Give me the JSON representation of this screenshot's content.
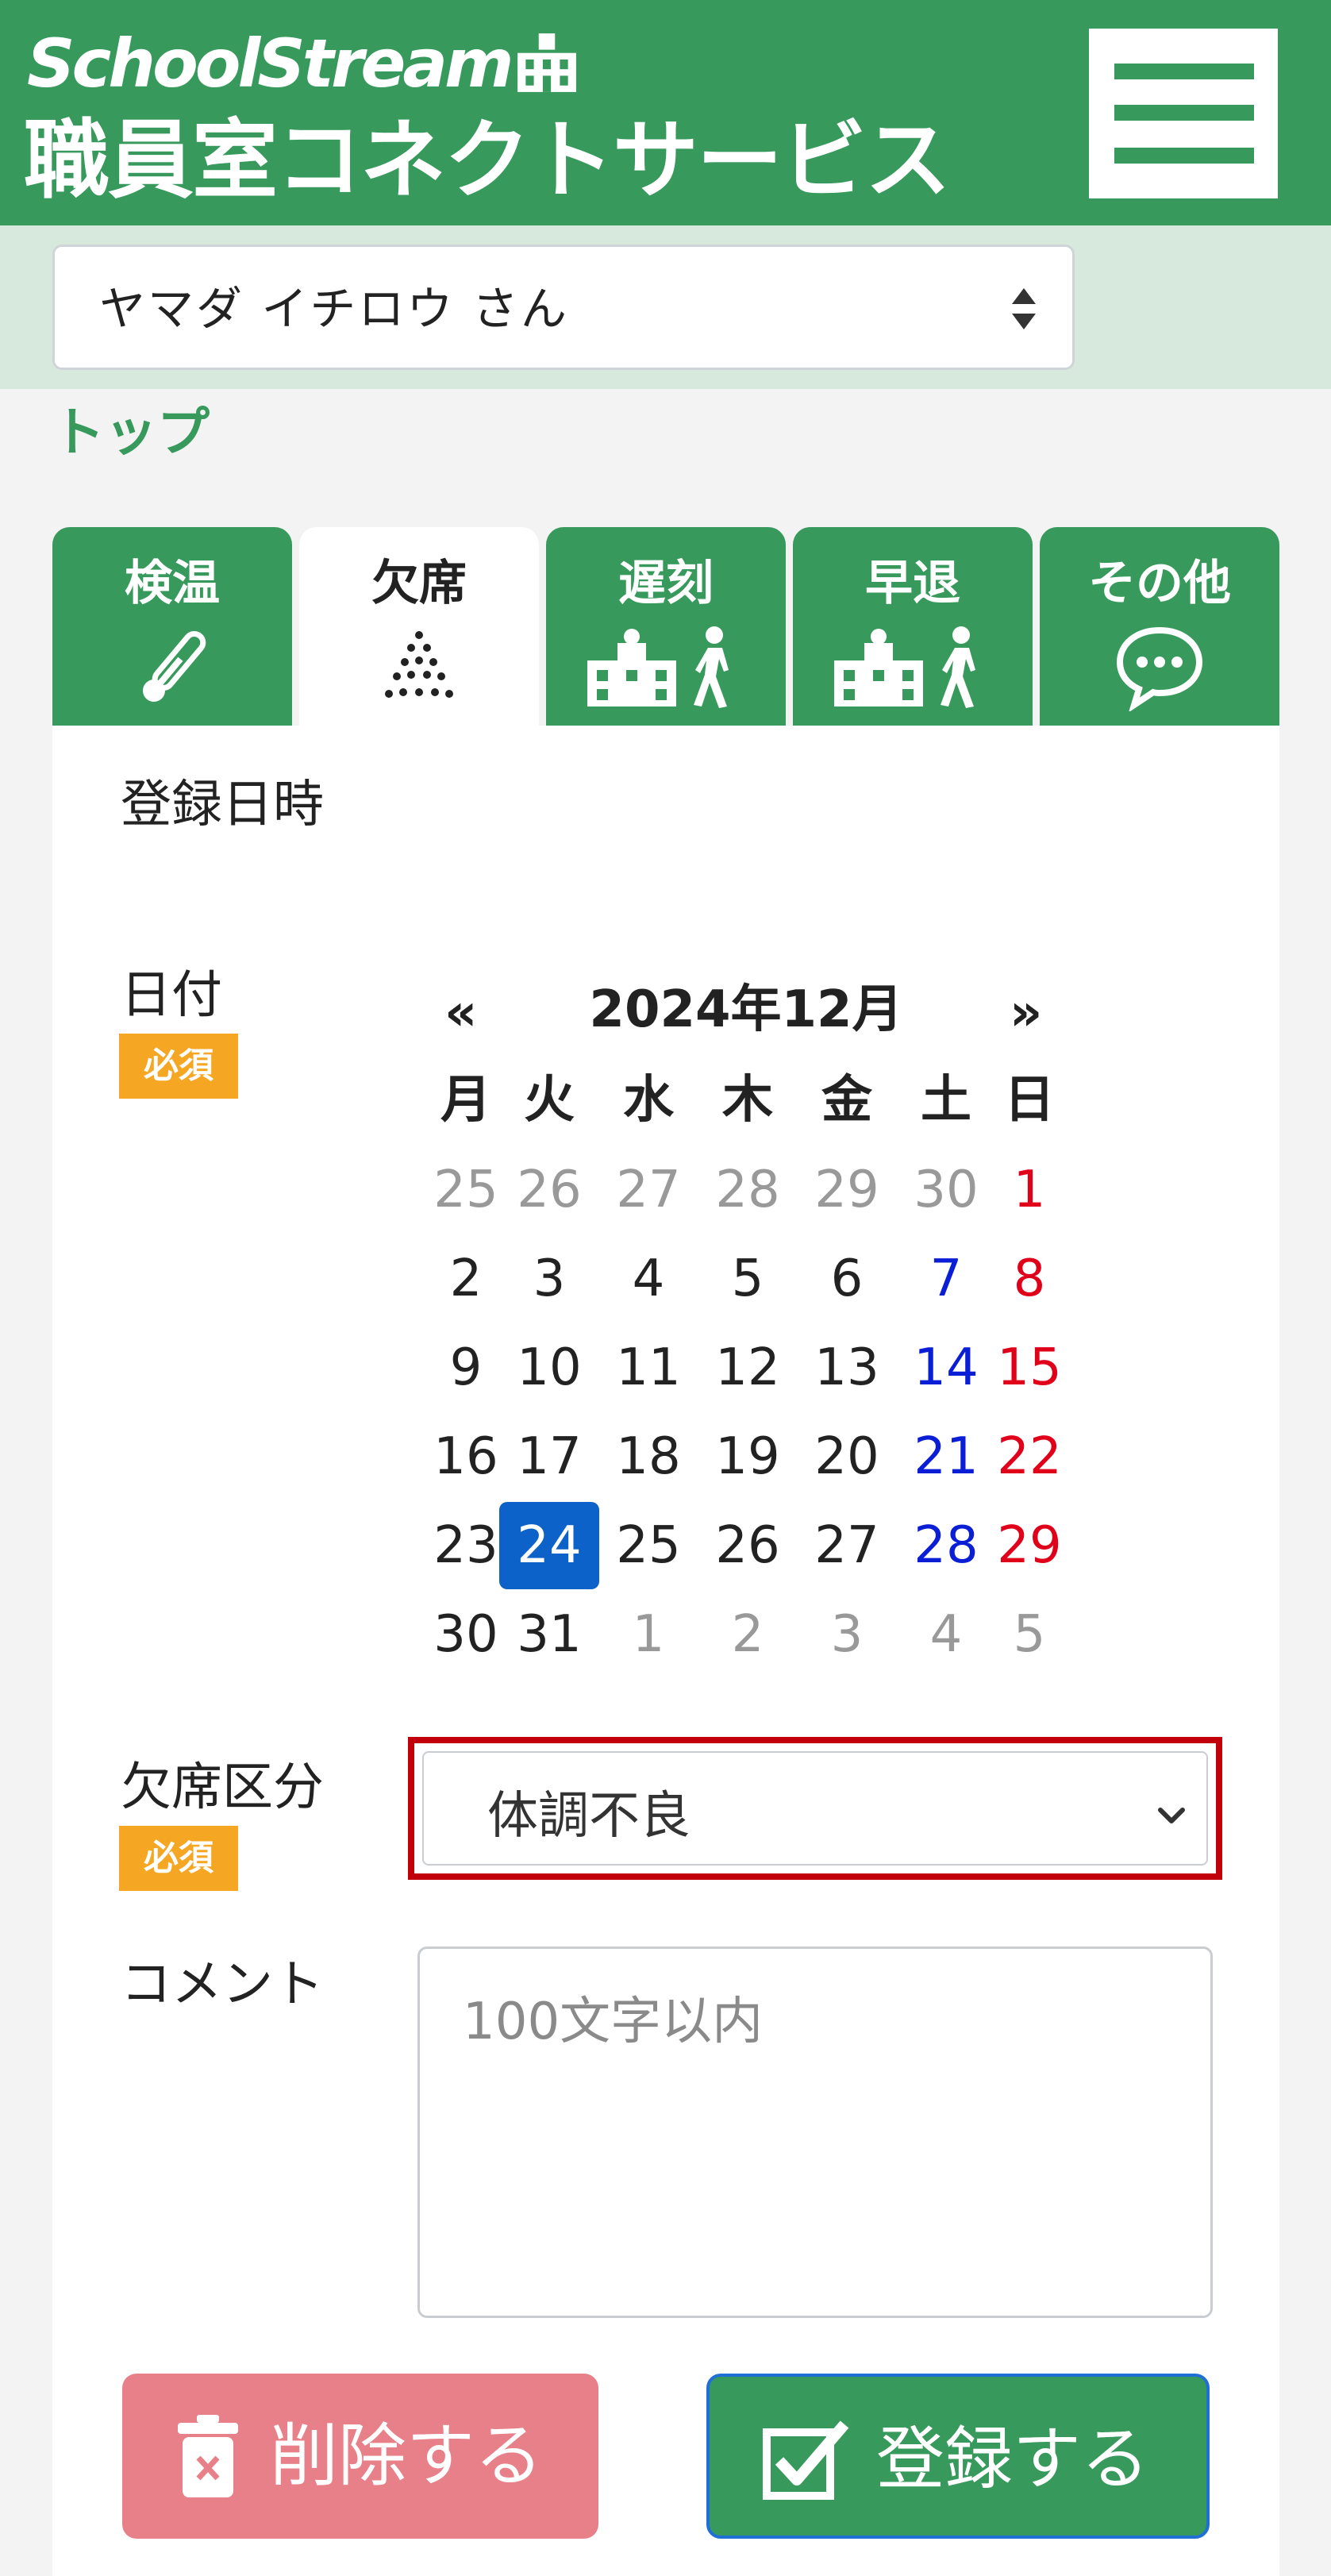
{
  "header": {
    "brand_line1": "SchoolStream",
    "brand_line2": "職員室コネクトサービス",
    "menu_icon": "hamburger-menu-icon",
    "colors": {
      "brand_green": "#379a5c",
      "light_green": "#d6e9dc"
    }
  },
  "user_select": {
    "value": "ヤマダ イチロウ さん"
  },
  "breadcrumb": {
    "label": "トップ"
  },
  "tabs": [
    {
      "label": "検温",
      "icon": "thermometer-icon",
      "active": false
    },
    {
      "label": "欠席",
      "icon": "sneeze-droplets-icon",
      "active": true
    },
    {
      "label": "遅刻",
      "icon": "school-walking-icon",
      "active": false
    },
    {
      "label": "早退",
      "icon": "school-walking-icon",
      "active": false
    },
    {
      "label": "その他",
      "icon": "chat-bubble-icon",
      "active": false
    }
  ],
  "form": {
    "registered_at_label": "登録日時",
    "date_label": "日付",
    "required_badge": "必須",
    "absence_type_label": "欠席区分",
    "absence_type_value": "体調不良",
    "comment_label": "コメント",
    "comment_placeholder": "100文字以内"
  },
  "calendar": {
    "prev": "«",
    "next": "»",
    "title": "2024年12月",
    "weekdays": [
      "月",
      "火",
      "水",
      "木",
      "金",
      "土",
      "日"
    ],
    "weeks": [
      [
        "25",
        "26",
        "27",
        "28",
        "29",
        "30",
        "1"
      ],
      [
        "2",
        "3",
        "4",
        "5",
        "6",
        "7",
        "8"
      ],
      [
        "9",
        "10",
        "11",
        "12",
        "13",
        "14",
        "15"
      ],
      [
        "16",
        "17",
        "18",
        "19",
        "20",
        "21",
        "22"
      ],
      [
        "23",
        "24",
        "25",
        "26",
        "27",
        "28",
        "29"
      ],
      [
        "30",
        "31",
        "1",
        "2",
        "3",
        "4",
        "5"
      ]
    ],
    "selected": "24",
    "colors": {
      "saturday": "#0a1ed6",
      "sunday": "#e0001a",
      "muted": "#999999",
      "selected_bg": "#0d62c9"
    }
  },
  "buttons": {
    "delete_label": "削除する",
    "register_label": "登録する"
  }
}
